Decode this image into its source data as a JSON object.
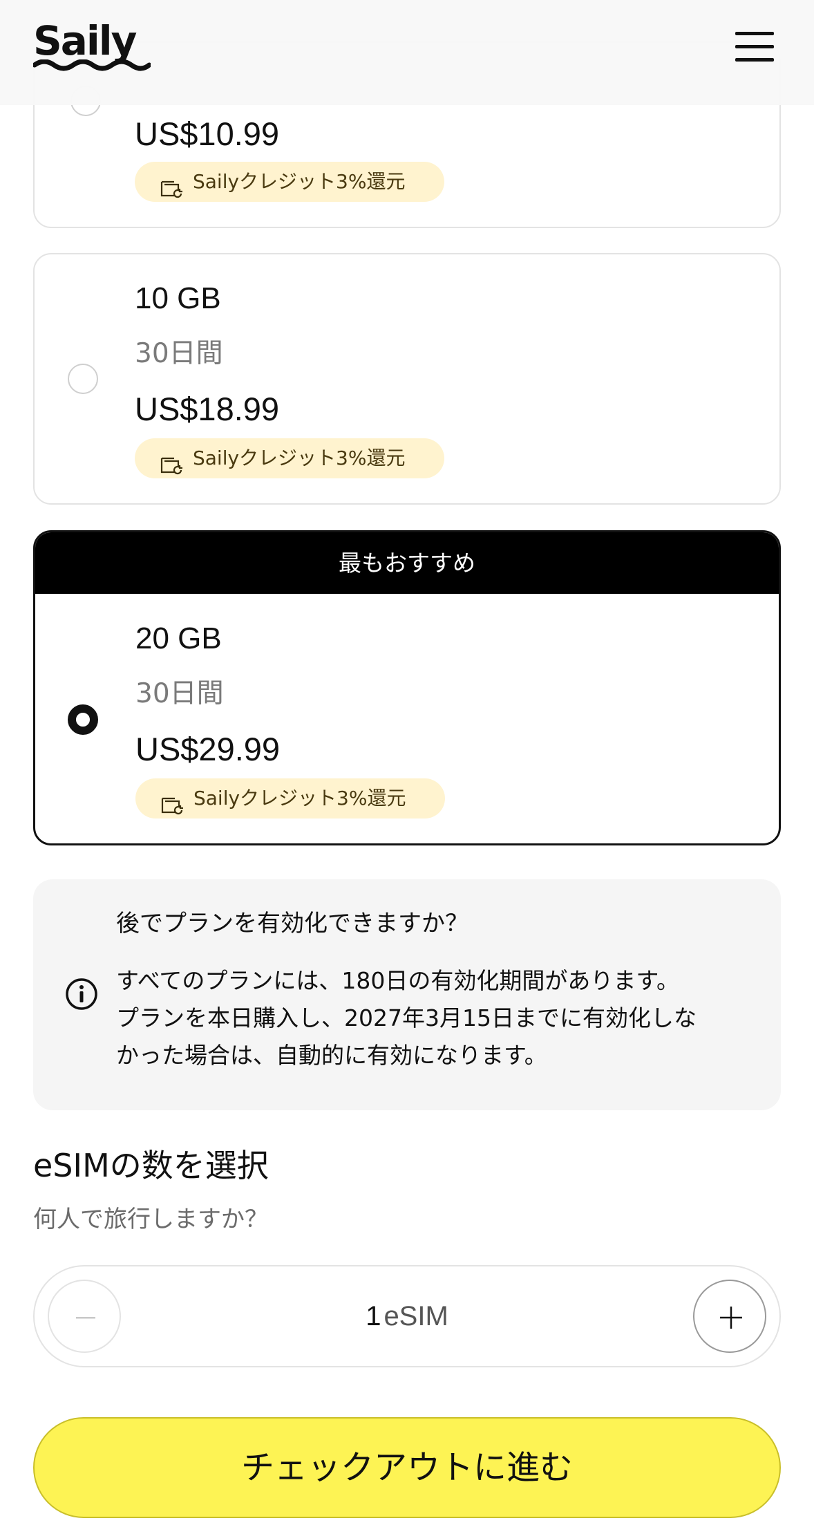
{
  "header": {
    "logo_text": "Saily",
    "menu_icon": "hamburger-menu-icon"
  },
  "plans": [
    {
      "data": "",
      "duration": "",
      "price": "US$10.99",
      "credit_label": "Sailyクレジット3%還元",
      "selected": false
    },
    {
      "data": "10 GB",
      "duration": "30日間",
      "price": "US$18.99",
      "credit_label": "Sailyクレジット3%還元",
      "selected": false
    },
    {
      "banner": "最もおすすめ",
      "data": "20 GB",
      "duration": "30日間",
      "price": "US$29.99",
      "credit_label": "Sailyクレジット3%還元",
      "selected": true
    }
  ],
  "info": {
    "icon": "info-icon",
    "title": "後でプランを有効化できますか？",
    "body_lines": [
      "すべてのプランには、180日の有効化期間があります。",
      "プランを本日購入し、2027年3月15日までに有効化しな",
      "かった場合は、自動的に有効になります。"
    ]
  },
  "esim": {
    "title": "eSIMの数を選択",
    "subtitle": "何人で旅行しますか？",
    "quantity": "1",
    "unit": "eSIM",
    "minus_icon": "minus-icon",
    "plus_icon": "plus-icon"
  },
  "checkout": {
    "label": "チェックアウトに進む"
  },
  "colors": {
    "accent_yellow": "#fdf354",
    "badge_bg": "#fff3cf",
    "banner_black": "#000000",
    "info_bg": "#f5f5f5"
  }
}
